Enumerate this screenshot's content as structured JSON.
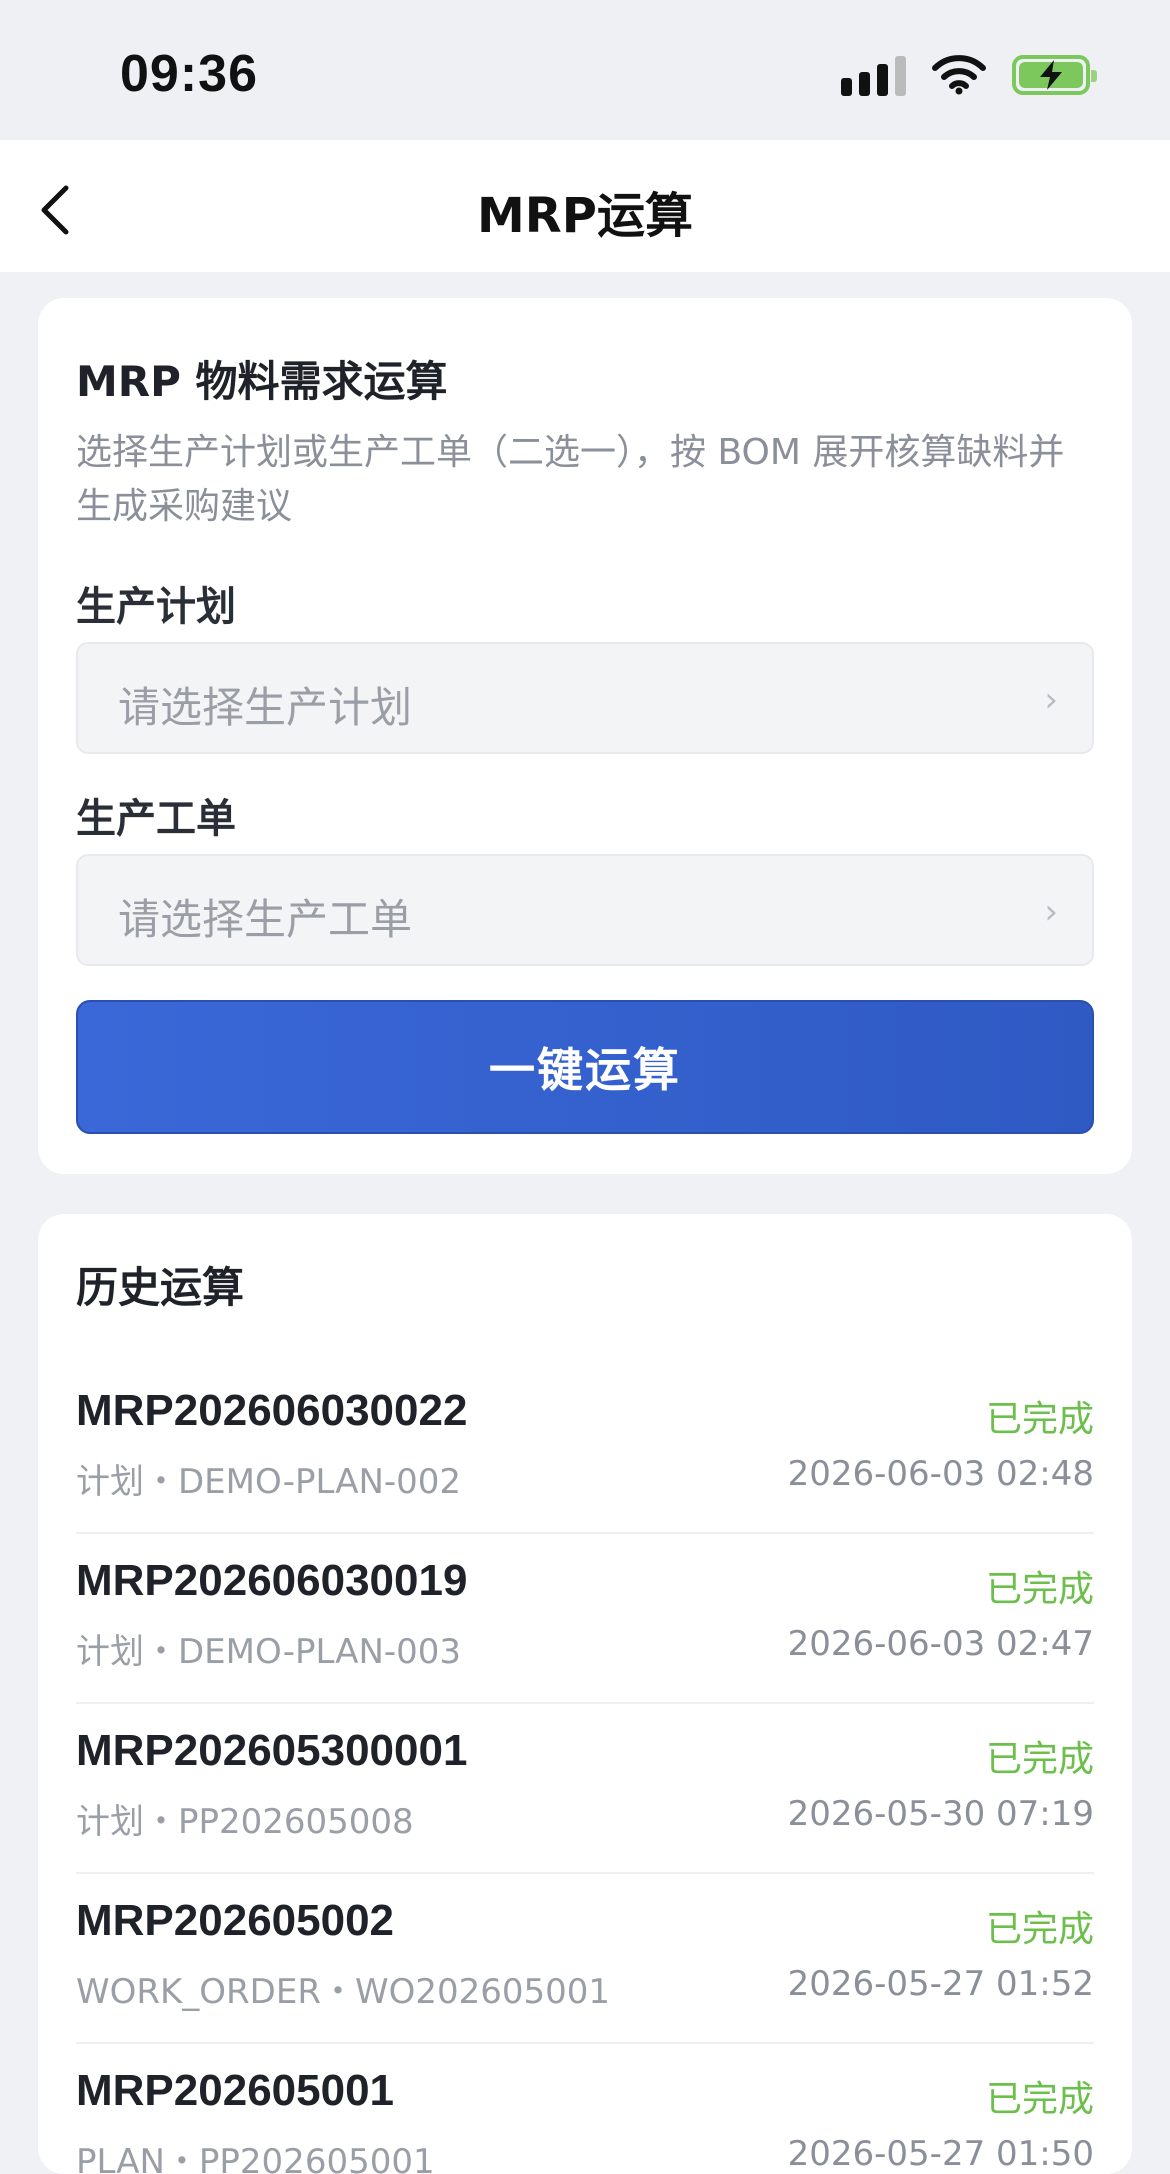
{
  "status_bar": {
    "time": "09:36"
  },
  "nav": {
    "title": "MRP运算"
  },
  "mrp": {
    "title": "MRP 物料需求运算",
    "description": "选择生产计划或生产工单（二选一），按 BOM 展开核算缺料并生成采购建议",
    "plan_label": "生产计划",
    "plan_placeholder": "请选择生产计划",
    "order_label": "生产工单",
    "order_placeholder": "请选择生产工单",
    "arrow": "›",
    "run_button": "一键运算"
  },
  "history": {
    "title": "历史运算",
    "items": [
      {
        "code": "MRP202606030022",
        "status": "已完成",
        "source": "计划・DEMO-PLAN-002",
        "time": "2026-06-03 02:48"
      },
      {
        "code": "MRP202606030019",
        "status": "已完成",
        "source": "计划・DEMO-PLAN-003",
        "time": "2026-06-03 02:47"
      },
      {
        "code": "MRP202605300001",
        "status": "已完成",
        "source": "计划・PP202605008",
        "time": "2026-05-30 07:19"
      },
      {
        "code": "MRP202605002",
        "status": "已完成",
        "source": "WORK_ORDER・WO202605001",
        "time": "2026-05-27 01:52"
      },
      {
        "code": "MRP202605001",
        "status": "已完成",
        "source": "PLAN・PP202605001",
        "time": "2026-05-27 01:50"
      }
    ]
  },
  "colors": {
    "primary": "#3a68d8",
    "success": "#6bbf4a",
    "background": "#f0f1f4"
  }
}
